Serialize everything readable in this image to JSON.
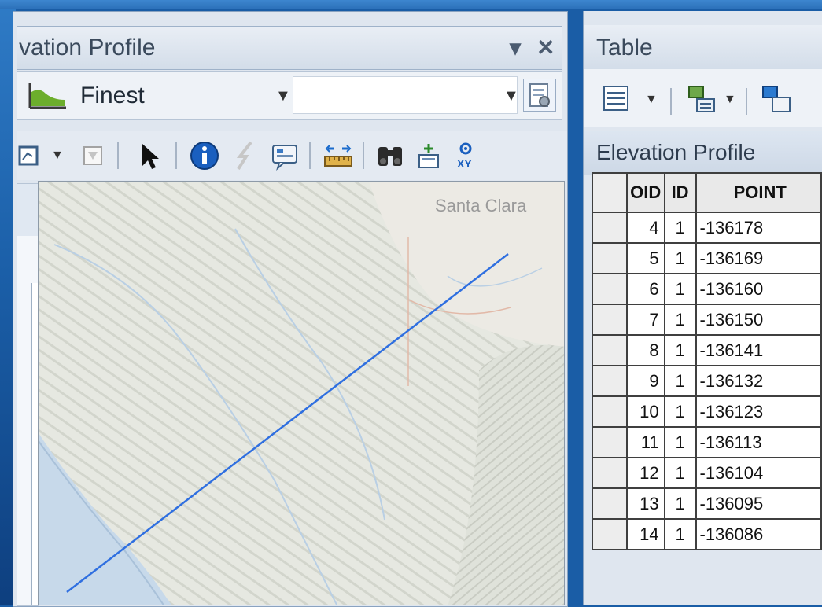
{
  "elevation_profile": {
    "title": "vation Profile",
    "window_controls": {
      "pin": "▾",
      "close": "✕"
    },
    "resolution_label": "Finest",
    "combo_value": "",
    "map_label": "Santa Clara",
    "toolbar_icons": [
      "graph-icon",
      "select-features-icon",
      "arrow-select-icon",
      "identify-icon",
      "lightning-icon",
      "html-popup-icon",
      "measure-icon",
      "find-icon",
      "add-xy-icon",
      "go-to-xy-icon"
    ]
  },
  "table": {
    "title": "Table",
    "caption": "Elevation Profile",
    "columns": [
      "",
      "OID",
      "ID",
      "POINT"
    ],
    "rows": [
      {
        "oid": "4",
        "id": "1",
        "point": "-136178"
      },
      {
        "oid": "5",
        "id": "1",
        "point": "-136169"
      },
      {
        "oid": "6",
        "id": "1",
        "point": "-136160"
      },
      {
        "oid": "7",
        "id": "1",
        "point": "-136150"
      },
      {
        "oid": "8",
        "id": "1",
        "point": "-136141"
      },
      {
        "oid": "9",
        "id": "1",
        "point": "-136132"
      },
      {
        "oid": "10",
        "id": "1",
        "point": "-136123"
      },
      {
        "oid": "11",
        "id": "1",
        "point": "-136113"
      },
      {
        "oid": "12",
        "id": "1",
        "point": "-136104"
      },
      {
        "oid": "13",
        "id": "1",
        "point": "-136095"
      },
      {
        "oid": "14",
        "id": "1",
        "point": "-136086"
      }
    ]
  },
  "colors": {
    "profile_line": "#2f6fe0",
    "window_bg": "#dfe6ef",
    "desktop": "#1a5da6"
  }
}
